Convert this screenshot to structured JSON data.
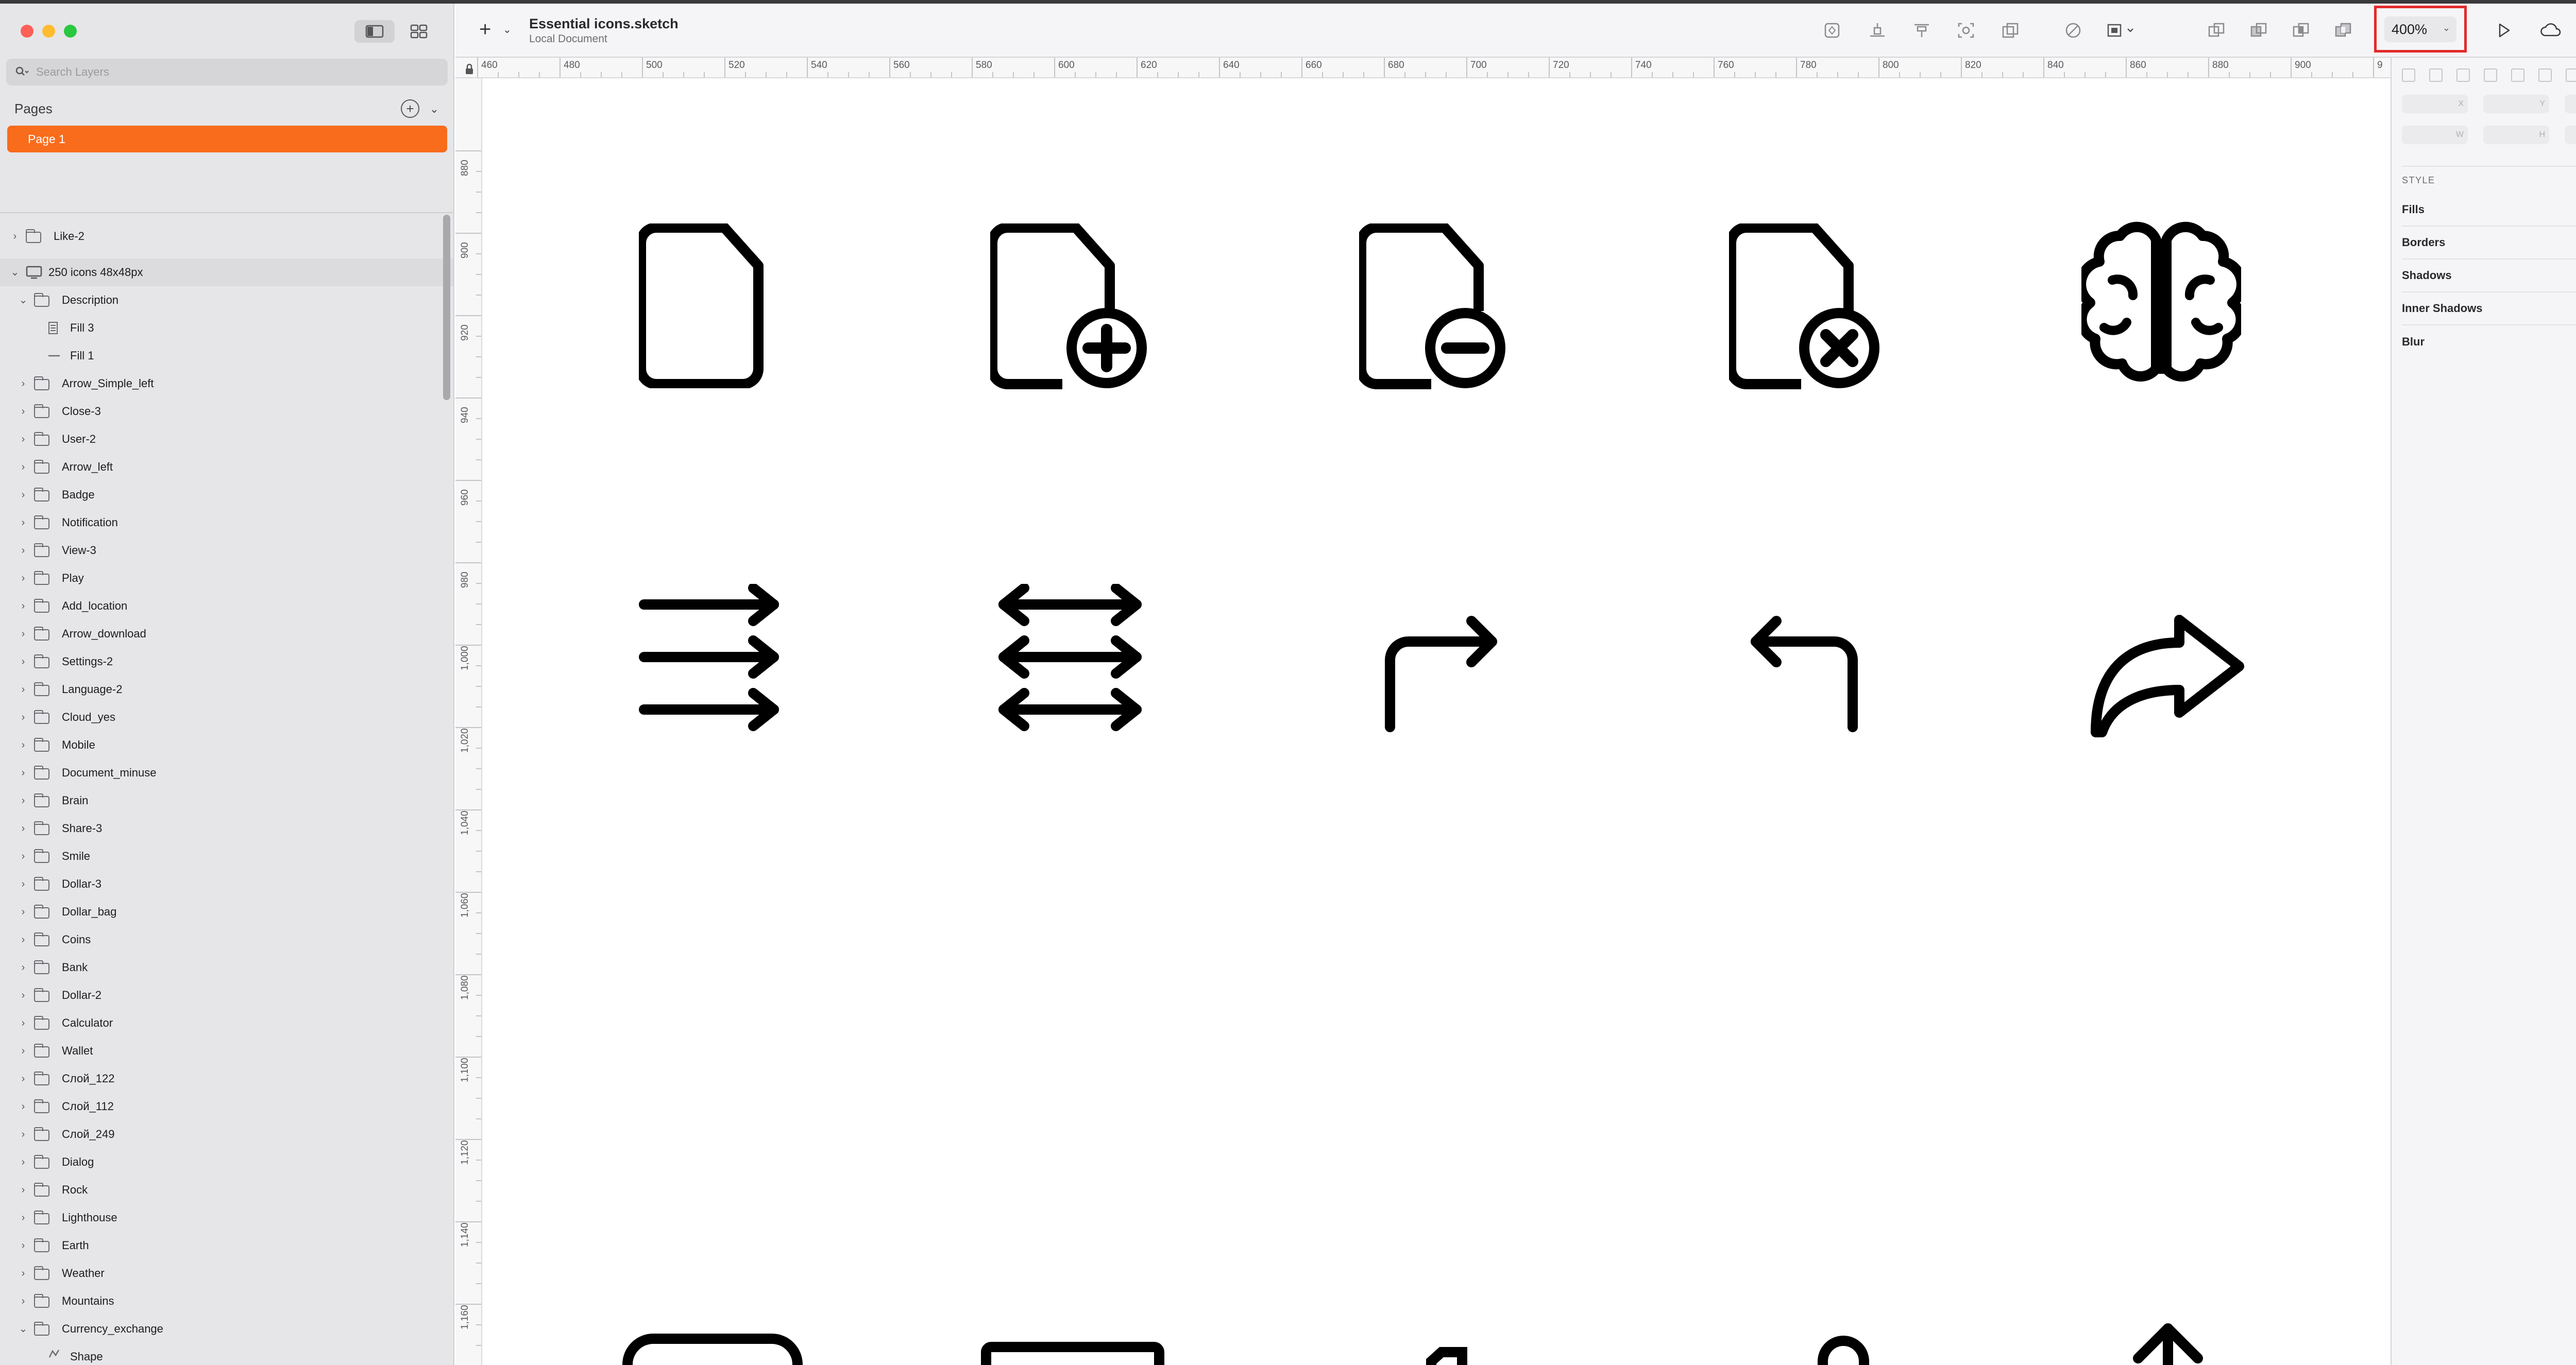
{
  "window": {
    "document_title": "Essential icons.sketch",
    "document_subtitle": "Local Document"
  },
  "sidebar": {
    "search_placeholder": "Search Layers",
    "pages_label": "Pages",
    "pages": [
      "Page 1"
    ],
    "layers": [
      {
        "label": "Like-2",
        "indent": 0,
        "type": "folder",
        "expanded": false
      },
      {
        "label": "250 icons 48x48px",
        "indent": 0,
        "type": "artboard",
        "expanded": true,
        "bold": true
      },
      {
        "label": "Description",
        "indent": 1,
        "type": "folder",
        "expanded": true
      },
      {
        "label": "Fill 3",
        "indent": 2,
        "type": "text"
      },
      {
        "label": "Fill 1",
        "indent": 2,
        "type": "line"
      },
      {
        "label": "Arrow_Simple_left",
        "indent": 1,
        "type": "folder",
        "expanded": false
      },
      {
        "label": "Close-3",
        "indent": 1,
        "type": "folder",
        "expanded": false
      },
      {
        "label": "User-2",
        "indent": 1,
        "type": "folder",
        "expanded": false
      },
      {
        "label": "Arrow_left",
        "indent": 1,
        "type": "folder",
        "expanded": false
      },
      {
        "label": "Badge",
        "indent": 1,
        "type": "folder",
        "expanded": false
      },
      {
        "label": "Notification",
        "indent": 1,
        "type": "folder",
        "expanded": false
      },
      {
        "label": "View-3",
        "indent": 1,
        "type": "folder",
        "expanded": false
      },
      {
        "label": "Play",
        "indent": 1,
        "type": "folder",
        "expanded": false
      },
      {
        "label": "Add_location",
        "indent": 1,
        "type": "folder",
        "expanded": false
      },
      {
        "label": "Arrow_download",
        "indent": 1,
        "type": "folder",
        "expanded": false
      },
      {
        "label": "Settings-2",
        "indent": 1,
        "type": "folder",
        "expanded": false
      },
      {
        "label": "Language-2",
        "indent": 1,
        "type": "folder",
        "expanded": false
      },
      {
        "label": "Cloud_yes",
        "indent": 1,
        "type": "folder",
        "expanded": false
      },
      {
        "label": "Mobile",
        "indent": 1,
        "type": "folder",
        "expanded": false
      },
      {
        "label": "Document_minuse",
        "indent": 1,
        "type": "folder",
        "expanded": false
      },
      {
        "label": "Brain",
        "indent": 1,
        "type": "folder",
        "expanded": false
      },
      {
        "label": "Share-3",
        "indent": 1,
        "type": "folder",
        "expanded": false
      },
      {
        "label": "Smile",
        "indent": 1,
        "type": "folder",
        "expanded": false
      },
      {
        "label": "Dollar-3",
        "indent": 1,
        "type": "folder",
        "expanded": false
      },
      {
        "label": "Dollar_bag",
        "indent": 1,
        "type": "folder",
        "expanded": false
      },
      {
        "label": "Coins",
        "indent": 1,
        "type": "folder",
        "expanded": false
      },
      {
        "label": "Bank",
        "indent": 1,
        "type": "folder",
        "expanded": false
      },
      {
        "label": "Dollar-2",
        "indent": 1,
        "type": "folder",
        "expanded": false
      },
      {
        "label": "Calculator",
        "indent": 1,
        "type": "folder",
        "expanded": false
      },
      {
        "label": "Wallet",
        "indent": 1,
        "type": "folder",
        "expanded": false
      },
      {
        "label": "Слой_122",
        "indent": 1,
        "type": "folder",
        "expanded": false
      },
      {
        "label": "Слой_112",
        "indent": 1,
        "type": "folder",
        "expanded": false
      },
      {
        "label": "Слой_249",
        "indent": 1,
        "type": "folder",
        "expanded": false
      },
      {
        "label": "Dialog",
        "indent": 1,
        "type": "folder",
        "expanded": false
      },
      {
        "label": "Rock",
        "indent": 1,
        "type": "folder",
        "expanded": false
      },
      {
        "label": "Lighthouse",
        "indent": 1,
        "type": "folder",
        "expanded": false
      },
      {
        "label": "Earth",
        "indent": 1,
        "type": "folder",
        "expanded": false
      },
      {
        "label": "Weather",
        "indent": 1,
        "type": "folder",
        "expanded": false
      },
      {
        "label": "Mountains",
        "indent": 1,
        "type": "folder",
        "expanded": false
      },
      {
        "label": "Currency_exchange",
        "indent": 1,
        "type": "folder",
        "expanded": true
      },
      {
        "label": "Shape",
        "indent": 2,
        "type": "shape"
      }
    ]
  },
  "toolbar": {
    "zoom_level": "400%",
    "icons": [
      "create-symbol-icon",
      "insert-layer-icon",
      "text-style-icon",
      "mask-icon",
      "scale-icon",
      "edit-path-icon",
      "transform-icon",
      "union-icon",
      "subtract-icon",
      "intersect-icon",
      "difference-icon"
    ],
    "right_icons": [
      "play-icon",
      "cloud-icon",
      "bell-icon"
    ]
  },
  "rulers": {
    "horizontal_labels": [
      "460",
      "480",
      "500",
      "520",
      "540",
      "560",
      "580",
      "600",
      "620",
      "640",
      "660",
      "680",
      "700",
      "720",
      "740",
      "760",
      "780",
      "800",
      "820",
      "840",
      "860",
      "880",
      "900",
      "9"
    ],
    "vertical_labels": [
      "880",
      "900",
      "920",
      "940",
      "960",
      "980",
      "1,000",
      "1,020",
      "1,040",
      "1,060",
      "1,080",
      "1,100",
      "1,120",
      "1,140",
      "1,160"
    ]
  },
  "canvas": {
    "icons": [
      "document-icon",
      "document-add-icon",
      "document-minus-icon",
      "document-remove-icon",
      "brain-icon",
      "arrows-right-icon",
      "arrows-left-right-icon",
      "arrow-turn-right-icon",
      "arrow-turn-left-icon",
      "share-arrow-icon"
    ]
  },
  "inspector": {
    "field_labels": [
      "X",
      "Y",
      "",
      "W",
      "H"
    ],
    "style_label": "STYLE",
    "sections": [
      "Fills",
      "Borders",
      "Shadows",
      "Inner Shadows",
      "Blur"
    ]
  },
  "colors": {
    "accent": "#f86c1b",
    "highlight_box": "#e32a2a",
    "sidebar_bg": "#e6e6e8",
    "icon_stroke": "#000000"
  }
}
